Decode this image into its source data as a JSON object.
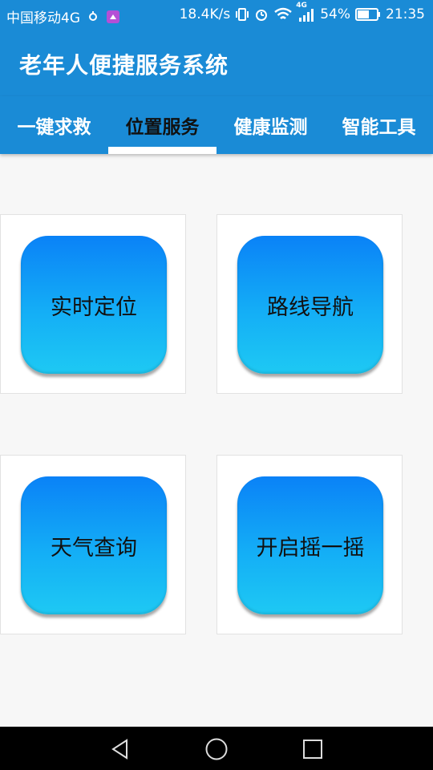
{
  "status_bar": {
    "carrier": "中国移动4G",
    "speed": "18.4K/s",
    "network": "4G",
    "battery": "54%",
    "time": "21:35",
    "icons": [
      "usb-debug-icon",
      "notification-icon",
      "vibrate-icon",
      "alarm-icon",
      "wifi-icon",
      "signal-icon",
      "battery-icon"
    ]
  },
  "app_bar": {
    "title": "老年人便捷服务系统"
  },
  "tabs": [
    {
      "label": "一键求救",
      "active": false
    },
    {
      "label": "位置服务",
      "active": true
    },
    {
      "label": "健康监测",
      "active": false
    },
    {
      "label": "智能工具",
      "active": false
    }
  ],
  "buttons": [
    {
      "label": "实时定位"
    },
    {
      "label": "路线导航"
    },
    {
      "label": "天气查询"
    },
    {
      "label": "开启摇一摇"
    }
  ],
  "nav_bar": {
    "icons": [
      "back-icon",
      "home-icon",
      "recents-icon"
    ]
  },
  "colors": {
    "primary": "#1a8bd6",
    "button_top": "#0a82f7",
    "button_bottom": "#1ec9f3",
    "background": "#f7f7f7"
  }
}
